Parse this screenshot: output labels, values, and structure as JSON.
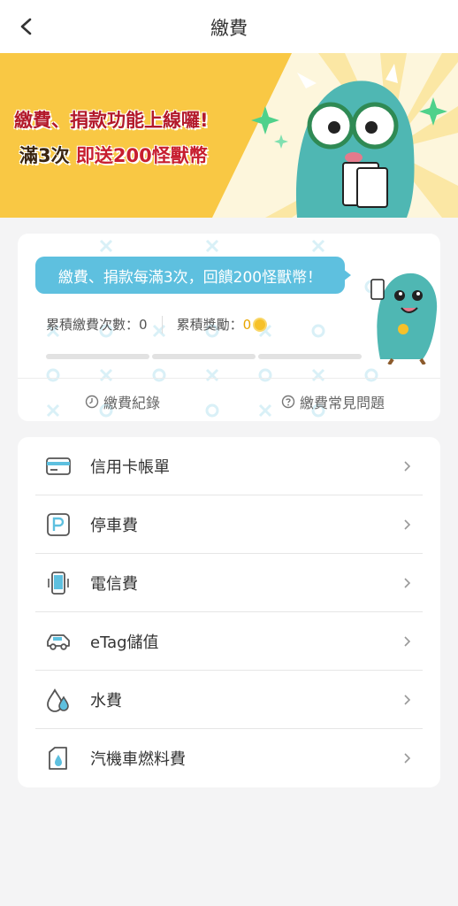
{
  "header": {
    "title": "繳費",
    "back_icon": "chevron-left-icon"
  },
  "banner": {
    "line1": "繳費、捐款功能上線囉!",
    "line2_prefix": "滿3次 ",
    "line2_highlight": "即送200怪獸幣"
  },
  "summary": {
    "bubble_text": "繳費、捐款每滿3次，回饋200怪獸幣！",
    "count_label": "累積繳費次數：",
    "count_value": "0",
    "reward_label": "累積獎勵：",
    "reward_value": "0",
    "progress_segments_filled": 0,
    "progress_segments_total": 3,
    "history_link": "繳費紀錄",
    "faq_link": "繳費常見問題"
  },
  "categories": [
    {
      "label": "信用卡帳單",
      "icon": "credit-card-icon"
    },
    {
      "label": "停車費",
      "icon": "parking-icon"
    },
    {
      "label": "電信費",
      "icon": "phone-icon"
    },
    {
      "label": "eTag儲值",
      "icon": "car-icon"
    },
    {
      "label": "水費",
      "icon": "water-drop-icon"
    },
    {
      "label": "汽機車燃料費",
      "icon": "fuel-icon"
    }
  ],
  "colors": {
    "banner_bg": "#f9c844",
    "accent": "#5ec0df",
    "coin": "#f6c12a"
  }
}
